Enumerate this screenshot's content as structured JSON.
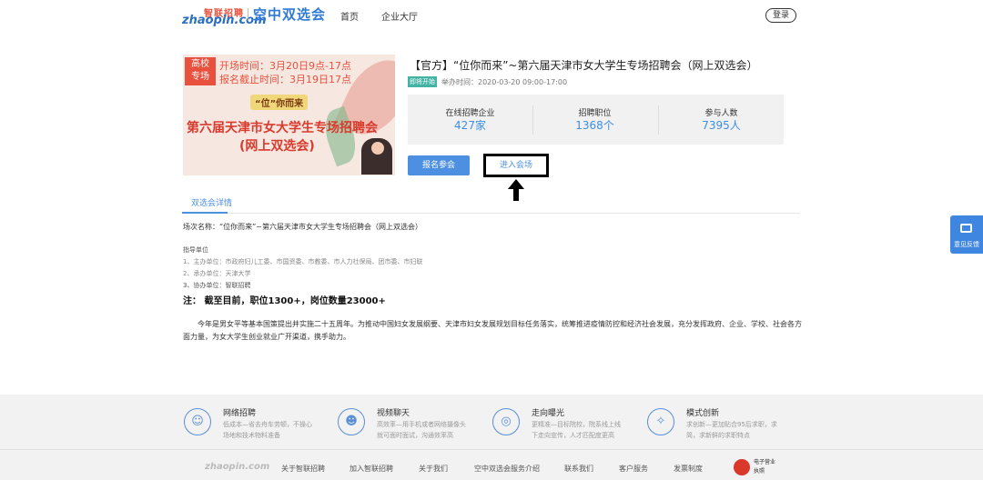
{
  "header": {
    "logo_top": "智联招聘",
    "logo_main": "zhaopin.com",
    "brand": "空中双选会",
    "nav": [
      {
        "label": "首页"
      },
      {
        "label": "企业大厅"
      }
    ],
    "login": "登录"
  },
  "banner": {
    "tag_line1": "高校",
    "tag_line2": "专场",
    "open_time": "开场时间：3月20日9点-17点",
    "deadline": "报名截止时间：3月19日17点",
    "slogan": "“位”你而来",
    "title_line1": "第六届天津市女大学生专场招聘会",
    "title_line2": "(网上双选会)"
  },
  "event": {
    "title": "【官方】“位你而来”~第六届天津市女大学生专场招聘会（网上双选会）",
    "status": "即将开始",
    "time": "举办时间：2020-03-20  09:00-17:00",
    "stats": [
      {
        "label": "在线招聘企业",
        "value": "427家"
      },
      {
        "label": "招聘职位",
        "value": "1368个"
      },
      {
        "label": "参与人数",
        "value": "7395人"
      }
    ],
    "signup": "报名参会",
    "enter": "进入会场"
  },
  "tabs": [
    {
      "label": "双选会详情"
    }
  ],
  "details": {
    "name": "场次名称：“位你而来”~第六届天津市女大学生专场招聘会（网上双选会）",
    "guide": "指导单位",
    "line1": "1、主办单位：市政府妇儿工委、市国资委、市教委、市人力社保局、团市委、市妇联",
    "line2": "2、承办单位：天津大学",
    "line3": "3、协办单位：智联招聘",
    "note": "注： 截至目前，职位1300+，岗位数量23000+",
    "para": "今年是男女平等基本国策提出并实施二十五周年。为推动中国妇女发展纲要、天津市妇女发展规划目标任务落实，统筹推进疫情防控和经济社会发展，充分发挥政府、企业、学校、社会各方面力量，为女大学生创业就业广开渠道，携手助力。"
  },
  "feedback": "意见反馈",
  "footer": {
    "features": [
      {
        "icon": "id-card-icon",
        "glyph": "☺",
        "title": "网络招聘",
        "desc": "低成本—省去舟车劳顿，不操心场地和技术物料准备"
      },
      {
        "icon": "chat-icon",
        "glyph": "☻",
        "title": "视频聊天",
        "desc": "高效率—用手机或者网络摄像头就可面时面试，沟通效率高"
      },
      {
        "icon": "target-icon",
        "glyph": "◎",
        "title": "走向曝光",
        "desc": "更精准—目标院校，院系线上线下走向宣传，人才匹配度更高"
      },
      {
        "icon": "bulb-icon",
        "glyph": "✧",
        "title": "模式创新",
        "desc": "求创新—更加贴合95后求职，求简，求新鲜的求职特点"
      }
    ],
    "logo": "zhaopin.com",
    "links": [
      {
        "label": "关于智联招聘"
      },
      {
        "label": "加入智联招聘"
      },
      {
        "label": "关于我们"
      },
      {
        "label": "空中双选会服务介绍"
      },
      {
        "label": "联系我们"
      },
      {
        "label": "客户服务"
      },
      {
        "label": "发票制度"
      }
    ],
    "badge_line1": "电子营业",
    "badge_line2": "执照"
  }
}
